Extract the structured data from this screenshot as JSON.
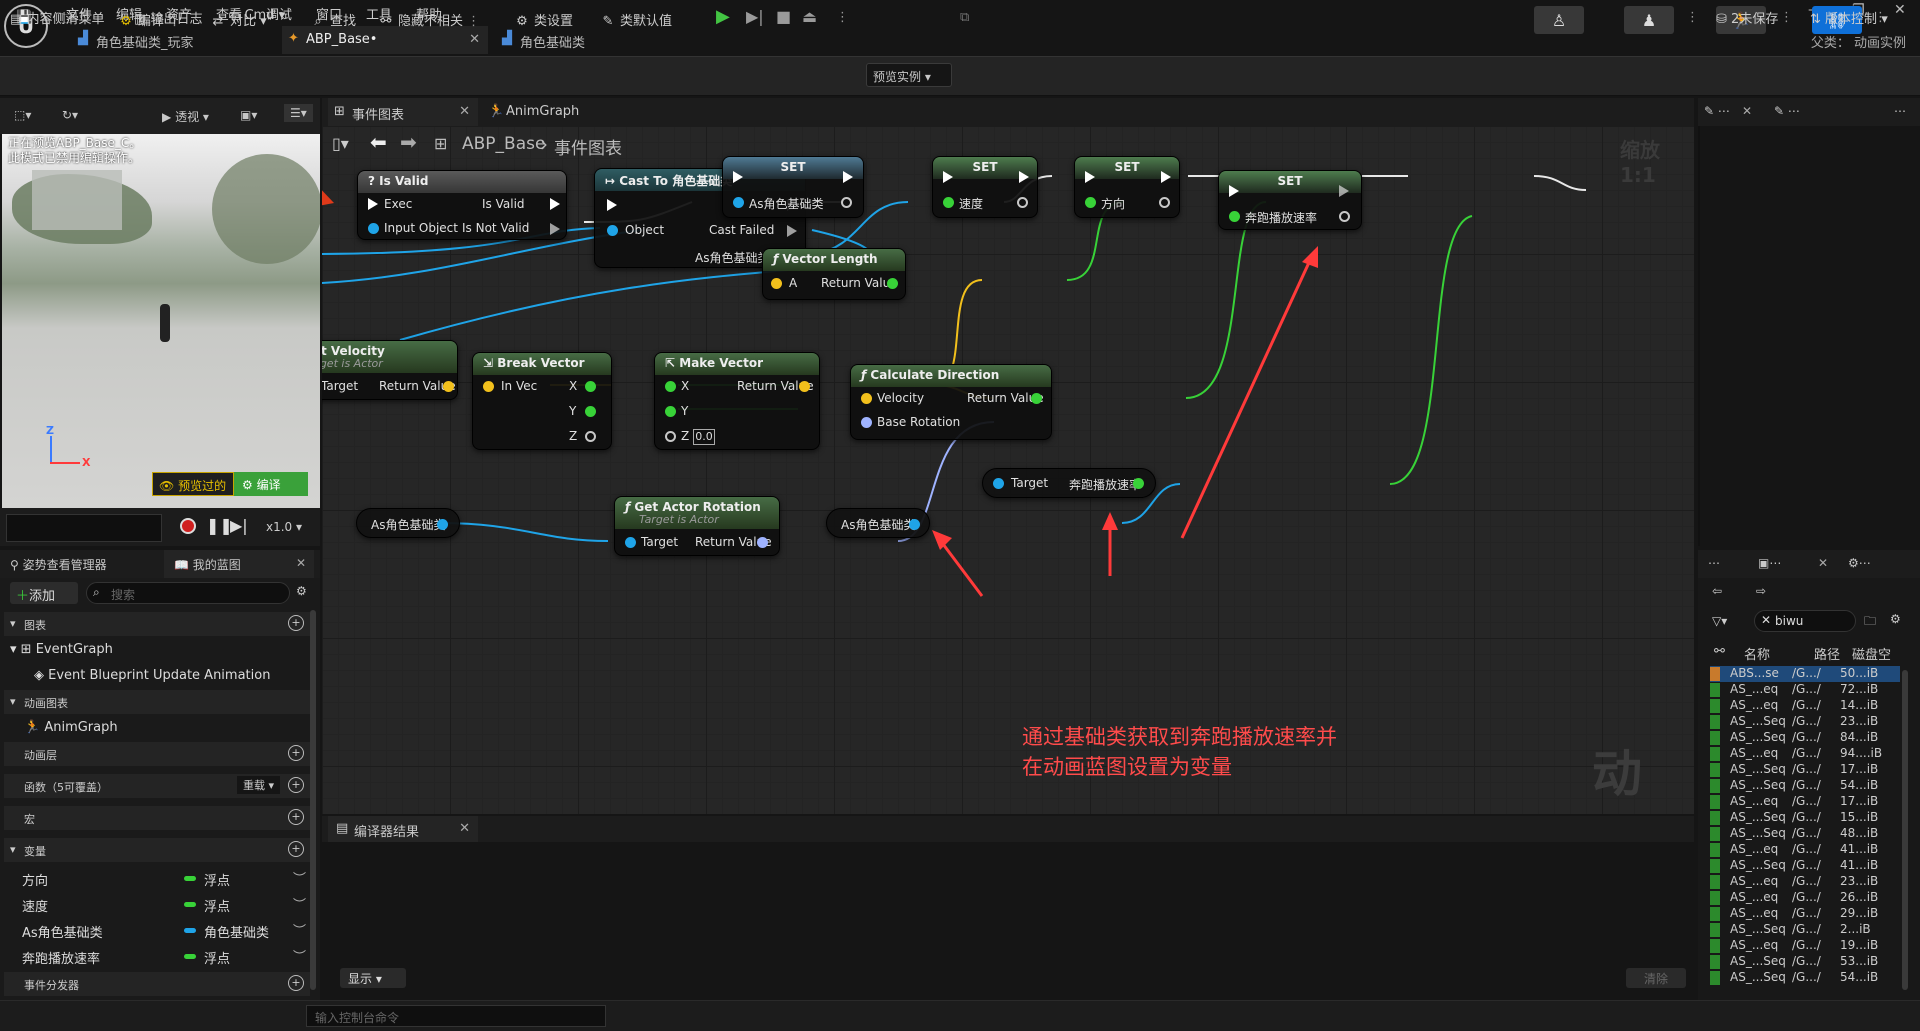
{
  "menu": [
    "文件",
    "编辑",
    "资产",
    "查看",
    "调试",
    "窗口",
    "工具",
    "帮助"
  ],
  "doc_tabs": [
    {
      "label": "角色基础类_玩家"
    },
    {
      "label": "ABP_Base•"
    },
    {
      "label": "角色基础类"
    }
  ],
  "parent_class": "父类：  动画实例",
  "toolbar": {
    "compile": "编译",
    "diff": "对比",
    "find": "查找",
    "hide_unrelated": "隐藏不相关",
    "class_settings": "类设置",
    "class_defaults": "类默认值",
    "preview_instance": "预览实例"
  },
  "viewport": {
    "perspective": "透视",
    "status": "正在预览ABP_Base_C。\n此模式已禁用编辑操作。",
    "axis_z": "Z",
    "axis_x": "X",
    "preview_button": "预览过的",
    "compile_button": "编译",
    "speed": "x1.0"
  },
  "left_tabs": {
    "pose": "姿势查看管理器",
    "myblueprint": "我的蓝图"
  },
  "myblueprint": {
    "add": "添加",
    "search_placeholder": "搜索",
    "sections": {
      "graphs": "图表",
      "anim_graphs": "动画图表",
      "anim_layers": "动画层",
      "functions": "函数（5可覆盖）",
      "override": "重载",
      "macros": "宏",
      "variables": "变量",
      "dispatchers": "事件分发器"
    },
    "event_graph": "EventGraph",
    "event_item": "Event Blueprint Update Animation",
    "anim_graph": "AnimGraph",
    "variables": [
      {
        "name": "方向",
        "type": "浮点",
        "color": "#38d238"
      },
      {
        "name": "速度",
        "type": "浮点",
        "color": "#38d238"
      },
      {
        "name": "As角色基础类",
        "type": "角色基础类",
        "color": "#1fa4e8"
      },
      {
        "name": "奔跑播放速率",
        "type": "浮点",
        "color": "#38d238"
      }
    ]
  },
  "status": {
    "drawer": "内容侧滑菜单",
    "log": "输出日志",
    "cmd": "Cmd",
    "console_placeholder": "输入控制台命令",
    "unsaved": "2未保存",
    "vcs": "版本控制"
  },
  "graph_tabs": [
    {
      "label": "事件图表"
    },
    {
      "label": "AnimGraph"
    }
  ],
  "graph": {
    "breadcrumb_root": "ABP_Base",
    "breadcrumb_sep": "›",
    "breadcrumb_leaf": "事件图表",
    "zoom": "缩放1:1"
  },
  "nodes": {
    "is_valid": {
      "title": "Is Valid",
      "exec": "Exec",
      "input_object": "Input Object",
      "out_valid": "Is Valid",
      "out_not_valid": "Is Not Valid"
    },
    "cast": {
      "title": "Cast To 角色基础类",
      "object": "Object",
      "cast_failed": "Cast Failed",
      "as_out": "As角色基础类"
    },
    "set1": {
      "title": "SET",
      "pin": "As角色基础类"
    },
    "set2": {
      "title": "SET",
      "pin": "速度"
    },
    "set3": {
      "title": "SET",
      "pin": "方向"
    },
    "set4": {
      "title": "SET",
      "pin": "奔跑播放速率"
    },
    "vector_length": {
      "title": "Vector Length",
      "a": "A",
      "ret": "Return Value"
    },
    "get_velocity": {
      "title": "Get Velocity",
      "sub": "Target is Actor",
      "target": "Target",
      "ret": "Return Value"
    },
    "break_vector": {
      "title": "Break Vector",
      "in": "In Vec",
      "x": "X",
      "y": "Y",
      "z": "Z"
    },
    "make_vector": {
      "title": "Make Vector",
      "x": "X",
      "y": "Y",
      "z": "Z",
      "z_val": "0.0",
      "ret": "Return Value"
    },
    "calc_direction": {
      "title": "Calculate Direction",
      "velocity": "Velocity",
      "base_rotation": "Base Rotation",
      "ret": "Return Value"
    },
    "get_actor_rotation": {
      "title": "Get Actor Rotation",
      "sub": "Target is Actor",
      "target": "Target",
      "ret": "Return Value"
    },
    "get_as1": {
      "label": "As角色基础类"
    },
    "get_as2": {
      "label": "As角色基础类"
    },
    "run_rate": {
      "target": "Target",
      "out": "奔跑播放速率"
    }
  },
  "annotation": {
    "line1": "通过基础类获取到奔跑播放速率并",
    "line2": "在动画蓝图设置为变量"
  },
  "watermark": "动画",
  "compiler": {
    "tab": "编译器结果",
    "show": "显示",
    "clear": "清除"
  },
  "content_browser": {
    "search_value": "biwu",
    "col_name": "名称",
    "col_path": "路径",
    "col_size": "磁盘空",
    "rows": [
      {
        "name": "ABS...se",
        "path": "/G.../",
        "size": "50...iB",
        "selected": true
      },
      {
        "name": "AS_...eq",
        "path": "/G.../",
        "size": "72...iB"
      },
      {
        "name": "AS_...eq",
        "path": "/G.../",
        "size": "14...iB"
      },
      {
        "name": "AS_...Seq",
        "path": "/G.../",
        "size": "23...iB"
      },
      {
        "name": "AS_...Seq",
        "path": "/G.../",
        "size": "84...iB"
      },
      {
        "name": "AS_...eq",
        "path": "/G.../",
        "size": "94....iB"
      },
      {
        "name": "AS_...Seq",
        "path": "/G.../",
        "size": "17...iB"
      },
      {
        "name": "AS_...Seq",
        "path": "/G.../",
        "size": "54...iB"
      },
      {
        "name": "AS_...eq",
        "path": "/G.../",
        "size": "17...iB"
      },
      {
        "name": "AS_...Seq",
        "path": "/G.../",
        "size": "15...iB"
      },
      {
        "name": "AS_...Seq",
        "path": "/G.../",
        "size": "48...iB"
      },
      {
        "name": "AS_...eq",
        "path": "/G.../",
        "size": "41...iB"
      },
      {
        "name": "AS_...Seq",
        "path": "/G.../",
        "size": "41...iB"
      },
      {
        "name": "AS_...eq",
        "path": "/G.../",
        "size": "23...iB"
      },
      {
        "name": "AS_...eq",
        "path": "/G.../",
        "size": "26...iB"
      },
      {
        "name": "AS_...eq",
        "path": "/G.../",
        "size": "29...iB"
      },
      {
        "name": "AS_...Seq",
        "path": "/G.../",
        "size": "2...iB"
      },
      {
        "name": "AS_...eq",
        "path": "/G.../",
        "size": "19...iB"
      },
      {
        "name": "AS_...Seq",
        "path": "/G.../",
        "size": "53...iB"
      },
      {
        "name": "AS_...Seq",
        "path": "/G.../",
        "size": "54...iB"
      }
    ]
  }
}
